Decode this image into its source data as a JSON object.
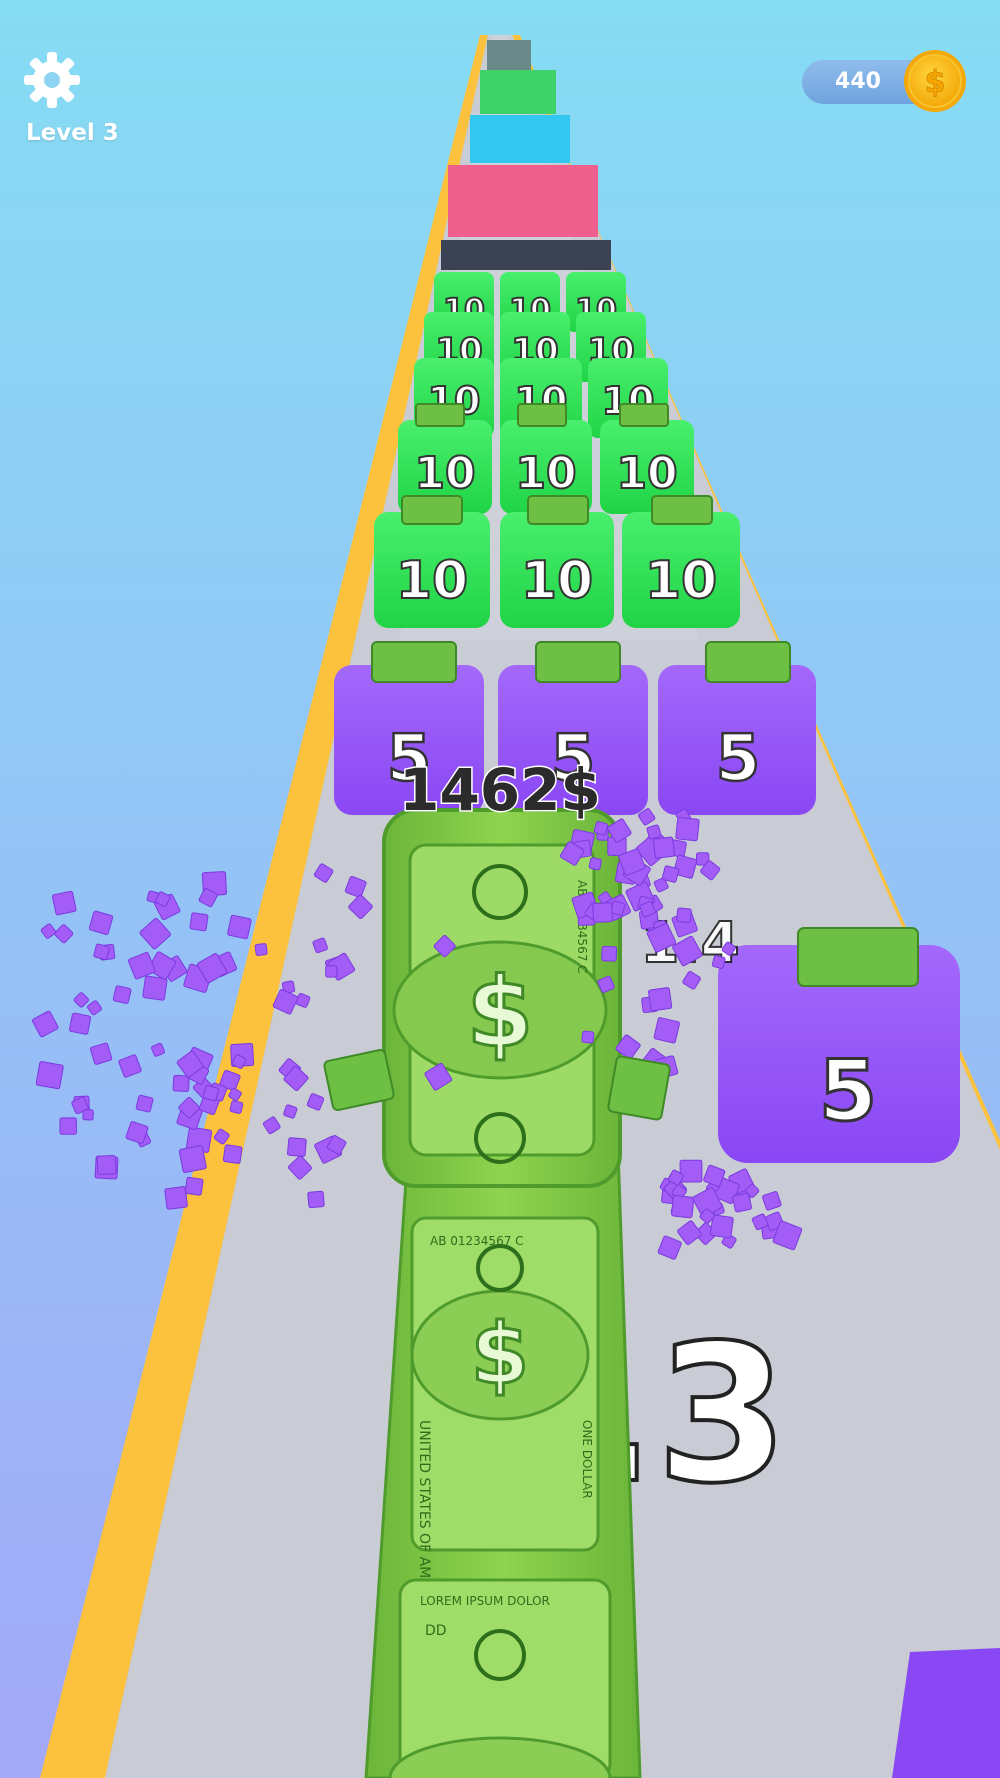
{
  "hud": {
    "level_label": "Level 3",
    "coin_count": "440",
    "coin_symbol": "$",
    "settings_icon": "gear-icon"
  },
  "runner": {
    "score_label": "1462$",
    "bill_symbol": "$",
    "bill_text": {
      "one_dollar": "ONE DOLLAR",
      "serial": "AB 01234567 C",
      "header": "LOREM IPSUM DOLOR",
      "united": "UNITED STATES OF AMERICA",
      "corner": "DD"
    }
  },
  "blocks": {
    "green_value": "10",
    "purple_value": "5",
    "side_block_value": "5"
  },
  "multipliers": {
    "front_multiplier": "1.3",
    "partial_multiplier": "1.4"
  },
  "colors": {
    "sky_top": "#86dcf3",
    "sky_bottom": "#a3a8f7",
    "track": "#c9ccd5",
    "track_edge": "#fcc13d",
    "money_green": "#7ecb3f",
    "block_green": "#2ee356",
    "block_purple": "#9a55f8",
    "coin": "#f9b90b"
  }
}
